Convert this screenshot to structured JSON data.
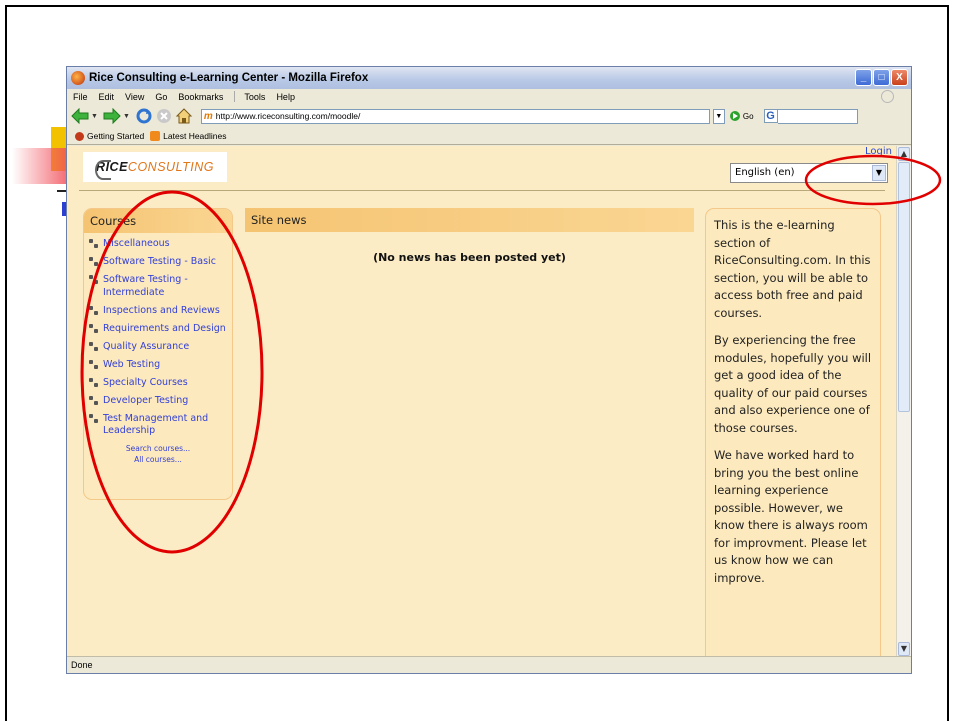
{
  "window": {
    "title": "Rice Consulting e-Learning Center - Mozilla Firefox",
    "controls": {
      "minimize": "_",
      "maximize": "□",
      "close": "X"
    }
  },
  "menu": [
    "File",
    "Edit",
    "View",
    "Go",
    "Bookmarks",
    "Tools",
    "Help"
  ],
  "toolbar": {
    "url": "http://www.riceconsulting.com/moodle/",
    "go_label": "Go",
    "search_logo": "G"
  },
  "bookmarks": [
    "Getting Started",
    "Latest Headlines"
  ],
  "header": {
    "logo_part1": "RICE",
    "logo_part2": "CONSULTING",
    "login": "Login",
    "language": "English (en)"
  },
  "courses": {
    "title": "Courses",
    "items": [
      "Miscellaneous",
      "Software Testing - Basic",
      "Software Testing - Intermediate",
      "Inspections and Reviews",
      "Requirements and Design",
      "Quality Assurance",
      "Web Testing",
      "Specialty Courses",
      "Developer Testing",
      "Test Management and Leadership"
    ],
    "search_link": "Search courses...",
    "all_link": "All courses..."
  },
  "news": {
    "title": "Site news",
    "empty_message": "(No news has been posted yet)"
  },
  "sidebar": {
    "paragraphs": [
      "This is the e-learning section of RiceConsulting.com.  In this section, you will be able to access both free and paid courses.",
      "By experiencing the free modules, hopefully you will get a good idea of the quality of our paid courses and also experience one of those courses.",
      "We have worked hard to bring you the best online learning experience possible. However, we know there is always room for improvment. Please let us know how we can improve."
    ]
  },
  "status": "Done",
  "colors": {
    "page_background": "#fcecc6",
    "header_band": "#f5c472",
    "link": "#3340d8",
    "annotation": "#e00000"
  }
}
